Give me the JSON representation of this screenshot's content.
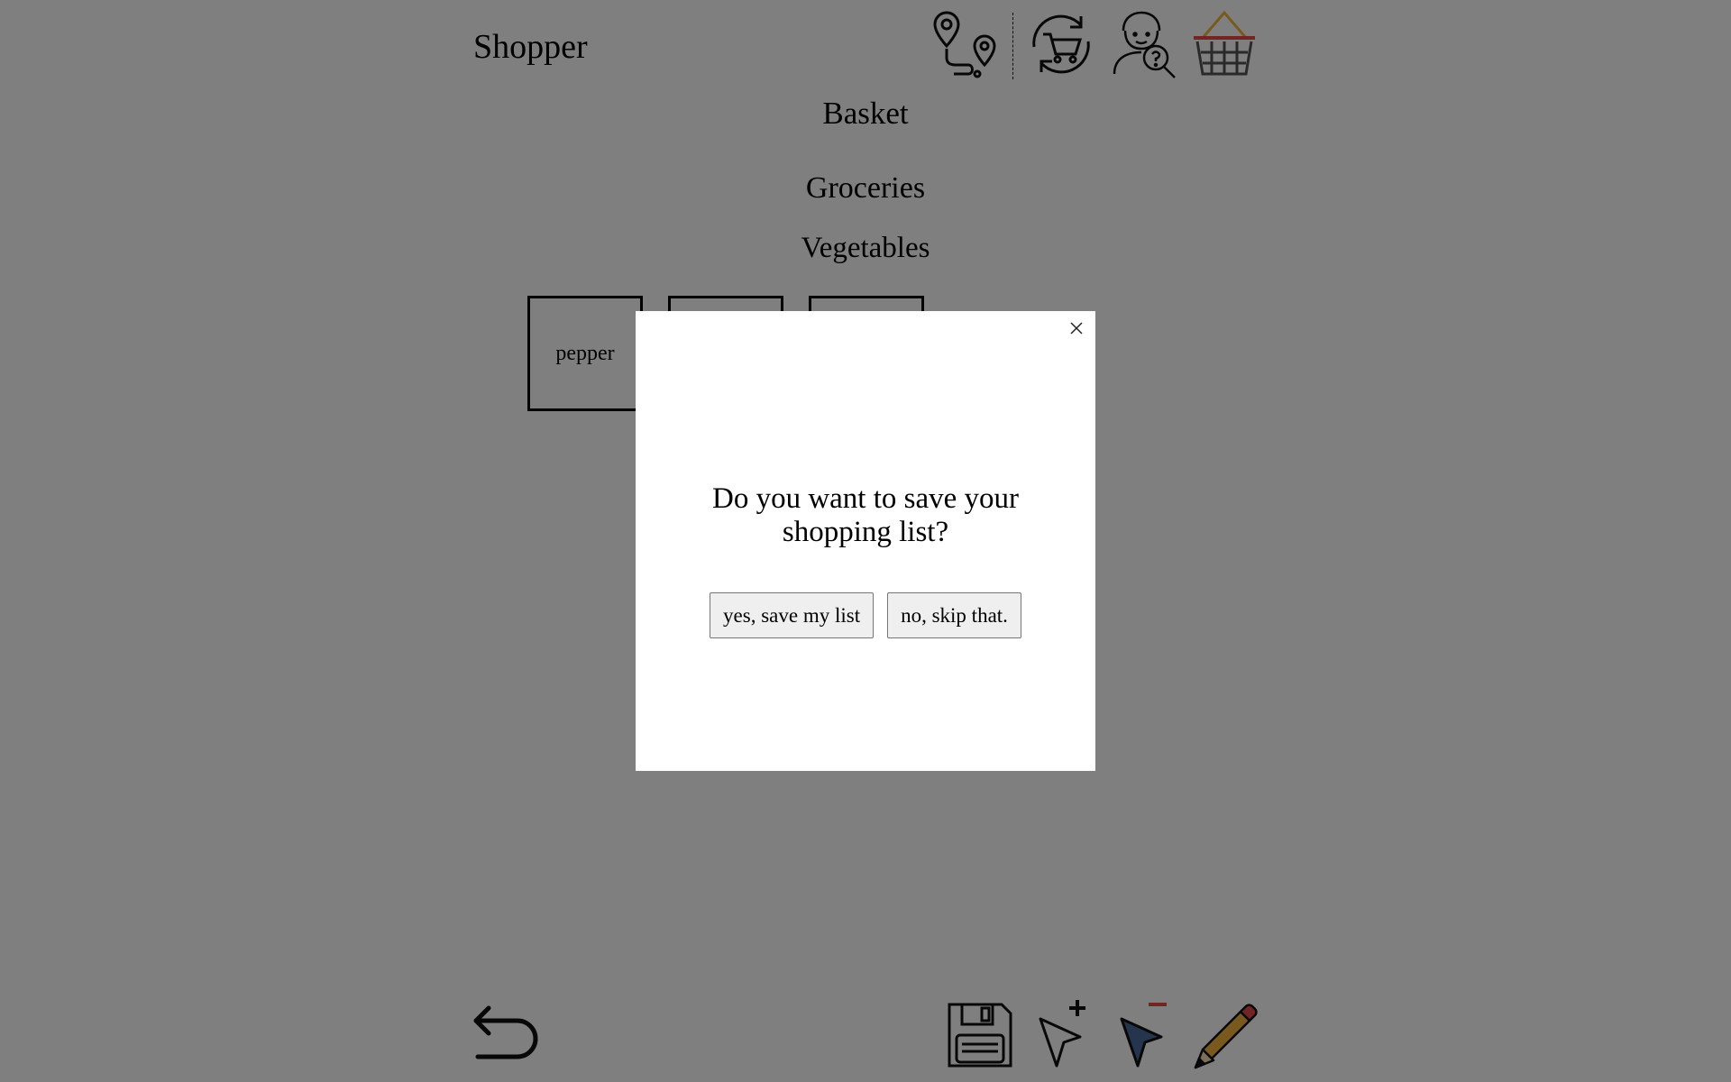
{
  "app": {
    "title": "Shopper"
  },
  "header_icons": [
    {
      "name": "route-map-pins-icon"
    },
    {
      "name": "cart-refresh-icon"
    },
    {
      "name": "user-help-search-icon"
    },
    {
      "name": "shopping-basket-icon"
    }
  ],
  "main": {
    "basket_heading": "Basket",
    "category_heading": "Groceries",
    "subcategory_heading": "Vegetables",
    "items": [
      {
        "label": "pepper"
      },
      {
        "label": ""
      },
      {
        "label": ""
      }
    ]
  },
  "modal": {
    "question": "Do you want to save your shopping list?",
    "confirm_label": "yes, save my list",
    "decline_label": "no, skip that.",
    "close_icon": "close-icon"
  },
  "bottom_bar": {
    "back_icon": "back-arrow-icon",
    "tools": [
      "save-disk-icon",
      "add-cursor-icon",
      "remove-cursor-icon",
      "pencil-edit-icon"
    ]
  },
  "colors": {
    "overlay": "rgba(0,0,0,0.5)",
    "basket_handle": "#f0b43c",
    "basket_rim": "#e24a4a",
    "pencil_body": "#f3b33d",
    "pencil_eraser": "#e24a4a",
    "cursor_remove_fill": "#4a6a9a",
    "minus_red": "#e24a4a"
  }
}
